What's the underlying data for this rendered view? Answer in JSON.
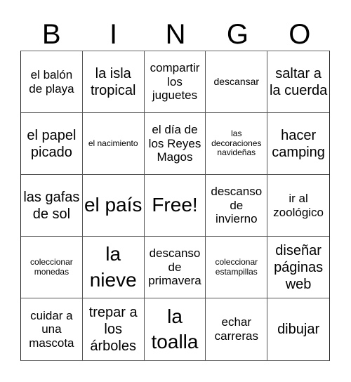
{
  "header": {
    "letters": [
      "B",
      "I",
      "N",
      "G",
      "O"
    ]
  },
  "cells": [
    {
      "text": "el balón de playa",
      "size": "md"
    },
    {
      "text": "la isla tropical",
      "size": "lg"
    },
    {
      "text": "compartir los juguetes",
      "size": "md"
    },
    {
      "text": "descansar",
      "size": "sm"
    },
    {
      "text": "saltar a la cuerda",
      "size": "lg"
    },
    {
      "text": "el papel picado",
      "size": "lg"
    },
    {
      "text": "el nacimiento",
      "size": "xs"
    },
    {
      "text": "el día de los Reyes Magos",
      "size": "md"
    },
    {
      "text": "las decoraciones navideñas",
      "size": "xs"
    },
    {
      "text": "hacer camping",
      "size": "lg"
    },
    {
      "text": "las gafas de sol",
      "size": "lg"
    },
    {
      "text": "el país",
      "size": "xl"
    },
    {
      "text": "Free!",
      "size": "xl"
    },
    {
      "text": "descanso de invierno",
      "size": "md"
    },
    {
      "text": "ir al zoológico",
      "size": "md"
    },
    {
      "text": "coleccionar monedas",
      "size": "xs"
    },
    {
      "text": "la nieve",
      "size": "xl"
    },
    {
      "text": "descanso de primavera",
      "size": "md"
    },
    {
      "text": "coleccionar estampillas",
      "size": "xs"
    },
    {
      "text": "diseñar páginas web",
      "size": "lg"
    },
    {
      "text": "cuidar a una mascota",
      "size": "md"
    },
    {
      "text": "trepar a los árboles",
      "size": "lg"
    },
    {
      "text": "la toalla",
      "size": "xl"
    },
    {
      "text": "echar carreras",
      "size": "md"
    },
    {
      "text": "dibujar",
      "size": "lg"
    }
  ]
}
